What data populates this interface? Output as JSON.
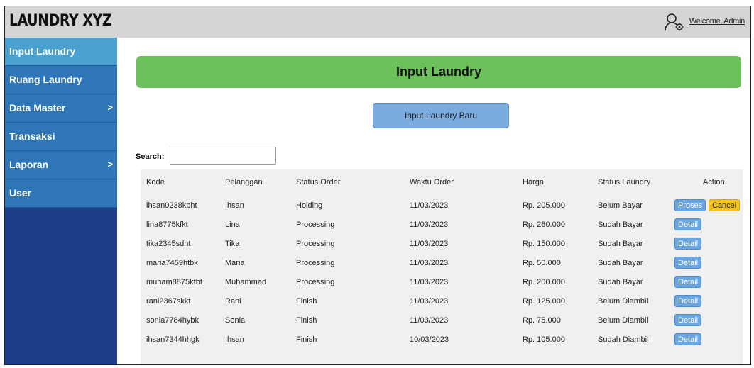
{
  "header": {
    "logo": "LAUNDRY XYZ",
    "welcome": "Welcome, Admin",
    "user_icon": "user-gear-icon"
  },
  "sidebar": {
    "items": [
      {
        "label": "Input Laundry",
        "caret": ""
      },
      {
        "label": "Ruang Laundry",
        "caret": ""
      },
      {
        "label": "Data Master",
        "caret": ">"
      },
      {
        "label": "Transaksi",
        "caret": ""
      },
      {
        "label": "Laporan",
        "caret": ">"
      },
      {
        "label": "User",
        "caret": ""
      }
    ]
  },
  "main": {
    "title": "Input Laundry",
    "new_button": "Input Laundry Baru",
    "search_label": "Search:",
    "search_value": ""
  },
  "table": {
    "headers": [
      "Kode",
      "Pelanggan",
      "Status Order",
      "Waktu Order",
      "Harga",
      "Status Laundry",
      "Action"
    ],
    "rows": [
      {
        "kode": "ihsan0238kpht",
        "pelanggan": "Ihsan",
        "status_order": "Holding",
        "waktu": "11/03/2023",
        "harga": "Rp. 205.000",
        "status_laundry": "Belum Bayar",
        "actions": [
          "Proses",
          "Cancel"
        ]
      },
      {
        "kode": "lina8775kfkt",
        "pelanggan": "Lina",
        "status_order": "Processing",
        "waktu": "11/03/2023",
        "harga": "Rp. 260.000",
        "status_laundry": "Sudah Bayar",
        "actions": [
          "Detail"
        ]
      },
      {
        "kode": "tika2345sdht",
        "pelanggan": "Tika",
        "status_order": "Processing",
        "waktu": "11/03/2023",
        "harga": "Rp. 150.000",
        "status_laundry": "Sudah Bayar",
        "actions": [
          "Detail"
        ]
      },
      {
        "kode": "maria7459htbk",
        "pelanggan": "Maria",
        "status_order": "Processing",
        "waktu": "11/03/2023",
        "harga": "Rp. 50.000",
        "status_laundry": "Sudah Bayar",
        "actions": [
          "Detail"
        ]
      },
      {
        "kode": "muham8875kfbt",
        "pelanggan": "Muhammad",
        "status_order": "Processing",
        "waktu": "11/03/2023",
        "harga": "Rp. 200.000",
        "status_laundry": "Sudah Bayar",
        "actions": [
          "Detail"
        ]
      },
      {
        "kode": "rani2367skkt",
        "pelanggan": "Rani",
        "status_order": "Finish",
        "waktu": "11/03/2023",
        "harga": "Rp. 125.000",
        "status_laundry": "Belum Diambil",
        "actions": [
          "Detail"
        ]
      },
      {
        "kode": "sonia7784hybk",
        "pelanggan": "Sonia",
        "status_order": "Finish",
        "waktu": "11/03/2023",
        "harga": "Rp. 75.000",
        "status_laundry": "Belum Diambil",
        "actions": [
          "Detail"
        ]
      },
      {
        "kode": "ihsan7344hhgk",
        "pelanggan": "Ihsan",
        "status_order": "Finish",
        "waktu": "10/03/2023",
        "harga": "Rp. 105.000",
        "status_laundry": "Sudah Diambil",
        "actions": [
          "Detail"
        ]
      }
    ]
  },
  "colors": {
    "sidebar_bg": "#1f3e88",
    "sidebar_item": "#2e76b8",
    "sidebar_active": "#4aa1cf",
    "banner": "#6bc05a",
    "button": "#7aace0",
    "cancel": "#f5c51e"
  }
}
